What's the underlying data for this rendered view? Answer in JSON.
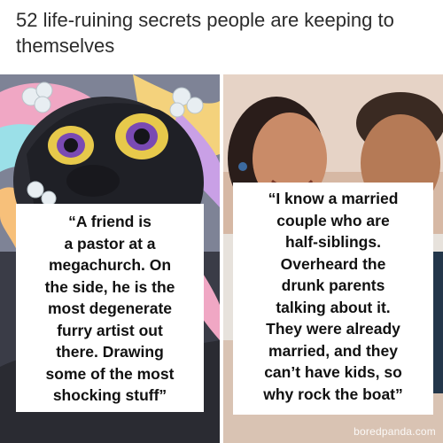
{
  "article": {
    "headline": "52 life-ruining secrets people are keeping to themselves"
  },
  "cards": [
    {
      "quote": "“A friend is\na pastor at a\nmegachurch. On\nthe side, he is the\nmost degenerate\nfurry artist out\nthere. Drawing\nsome of the most\nshocking stuff”"
    },
    {
      "quote": "“I know a married\ncouple who are\nhalf-siblings.\nOverheard the\ndrunk parents\ntalking about it.\nThey were already\nmarried, and they\ncan’t have kids, so\nwhy rock the boat”"
    }
  ],
  "watermark": "boredpanda.com"
}
